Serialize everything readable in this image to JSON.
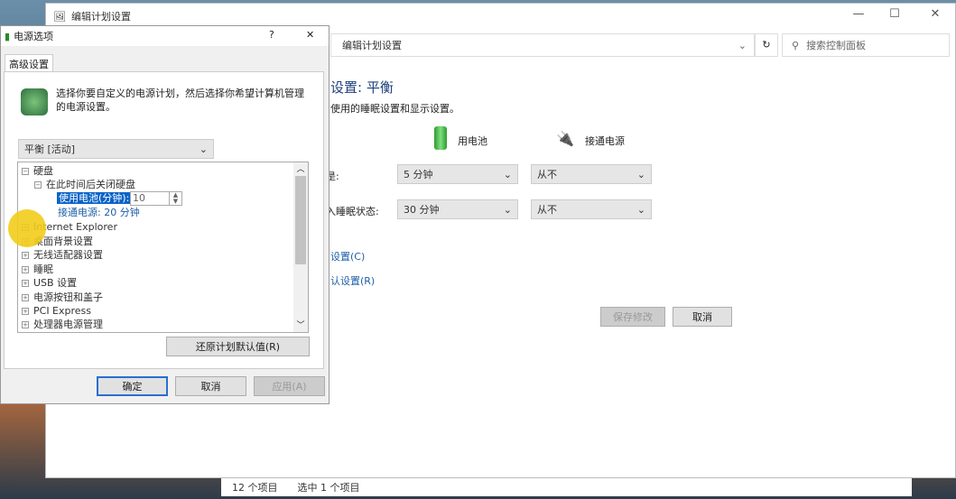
{
  "back_window": {
    "title": "编辑计划设置",
    "address": "编辑计划设置",
    "search_placeholder": "搜索控制面板",
    "heading": "设置: 平衡",
    "subtitle": "使用的睡眠设置和显示设置。",
    "col_battery": "用电池",
    "col_plugged": "接通电源",
    "rows": [
      {
        "label": "是:",
        "battery": "5 分钟",
        "plugged": "从不"
      },
      {
        "label": "入睡眠状态:",
        "battery": "30 分钟",
        "plugged": "从不"
      }
    ],
    "link_advanced": "设置(C)",
    "link_restore": "认设置(R)",
    "save": "保存修改",
    "cancel": "取消"
  },
  "status_bar": {
    "count": "12 个项目",
    "selected": "选中 1 个项目"
  },
  "dialog": {
    "title": "电源选项",
    "help": "?",
    "close": "✕",
    "tab": "高级设置",
    "description": "选择你要自定义的电源计划，然后选择你希望计算机管理的电源设置。",
    "plan": "平衡 [活动]",
    "tree": {
      "hard_disk": "硬盘",
      "turn_off": "在此时间后关闭硬盘",
      "battery_label": "使用电池(分钟):",
      "battery_value": "10",
      "plugged": "接通电源: 20 分钟",
      "items": [
        "Internet Explorer",
        "桌面背景设置",
        "无线适配器设置",
        "睡眠",
        "USB 设置",
        "电源按钮和盖子",
        "PCI Express",
        "处理器电源管理"
      ]
    },
    "restore": "还原计划默认值(R)",
    "ok": "确定",
    "cancel": "取消",
    "apply": "应用(A)"
  }
}
